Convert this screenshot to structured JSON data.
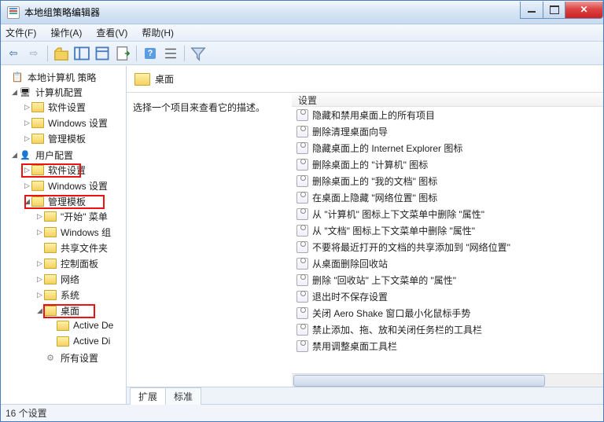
{
  "window": {
    "title": "本地组策略编辑器"
  },
  "menus": {
    "file": "文件(F)",
    "action": "操作(A)",
    "view": "查看(V)",
    "help": "帮助(H)"
  },
  "tree": {
    "root": "本地计算机 策略",
    "computer_config": "计算机配置",
    "cc_software": "软件设置",
    "cc_windows": "Windows 设置",
    "cc_admin": "管理模板",
    "user_config": "用户配置",
    "uc_software": "软件设置",
    "uc_windows": "Windows 设置",
    "uc_admin": "管理模板",
    "admin_start": "\"开始\" 菜单",
    "admin_wincomp": "Windows 组",
    "admin_shared": "共享文件夹",
    "admin_cpl": "控制面板",
    "admin_net": "网络",
    "admin_sys": "系统",
    "admin_desktop": "桌面",
    "admin_ad_de": "Active De",
    "admin_ad_di": "Active Di",
    "all_settings": "所有设置"
  },
  "detail": {
    "heading": "桌面",
    "prompt": "选择一个项目来查看它的描述。",
    "column_setting": "设置",
    "items": [
      "隐藏和禁用桌面上的所有项目",
      "删除清理桌面向导",
      "隐藏桌面上的 Internet Explorer 图标",
      "删除桌面上的 \"计算机\" 图标",
      "删除桌面上的 \"我的文档\" 图标",
      "在桌面上隐藏 \"网络位置\" 图标",
      "从 \"计算机\" 图标上下文菜单中删除 \"属性\"",
      "从 \"文档\" 图标上下文菜单中删除 \"属性\"",
      "不要将最近打开的文档的共享添加到 \"网络位置\"",
      "从桌面删除回收站",
      "删除 \"回收站\" 上下文菜单的 \"属性\"",
      "退出时不保存设置",
      "关闭 Aero Shake 窗口最小化鼠标手势",
      "禁止添加、拖、放和关闭任务栏的工具栏",
      "禁用调整桌面工具栏"
    ]
  },
  "tabs": {
    "extended": "扩展",
    "standard": "标准"
  },
  "status": {
    "count": "16 个设置"
  }
}
